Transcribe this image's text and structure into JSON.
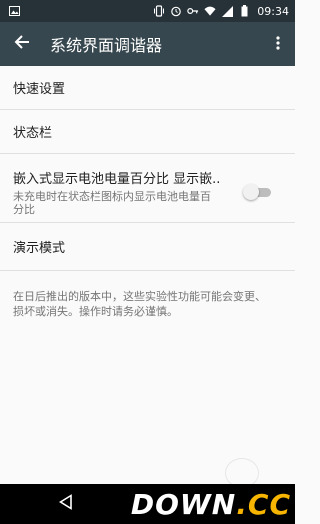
{
  "status_bar": {
    "time": "09:34",
    "icons": [
      "image-icon",
      "vibrate-icon",
      "alarm-icon",
      "key-icon",
      "wifi-icon",
      "signal-icon",
      "battery-icon"
    ]
  },
  "app_bar": {
    "title": "系统界面调谐器",
    "back_icon": "arrow-back-icon",
    "menu_icon": "more-vert-icon"
  },
  "preferences": [
    {
      "title": "快速设置"
    },
    {
      "title": "状态栏"
    },
    {
      "title": "嵌入式显示电池电量百分比 显示嵌..",
      "summary": "未充电时在状态栏图标内显示电池电量百分比",
      "toggle": {
        "checked": false
      }
    },
    {
      "title": "演示模式"
    }
  ],
  "footer_note": "在日后推出的版本中，这些实验性功能可能会变更、损坏或消失。操作时请务必谨慎。",
  "nav_bar": {
    "back_icon": "nav-back-icon"
  },
  "watermark": {
    "main": "DOWN",
    "dot": ".",
    "suffix": "CC"
  },
  "colors": {
    "status_bar": "#263238",
    "app_bar": "#37474f",
    "background": "#fafafa",
    "text_primary": "#212121",
    "text_secondary": "#757575"
  }
}
